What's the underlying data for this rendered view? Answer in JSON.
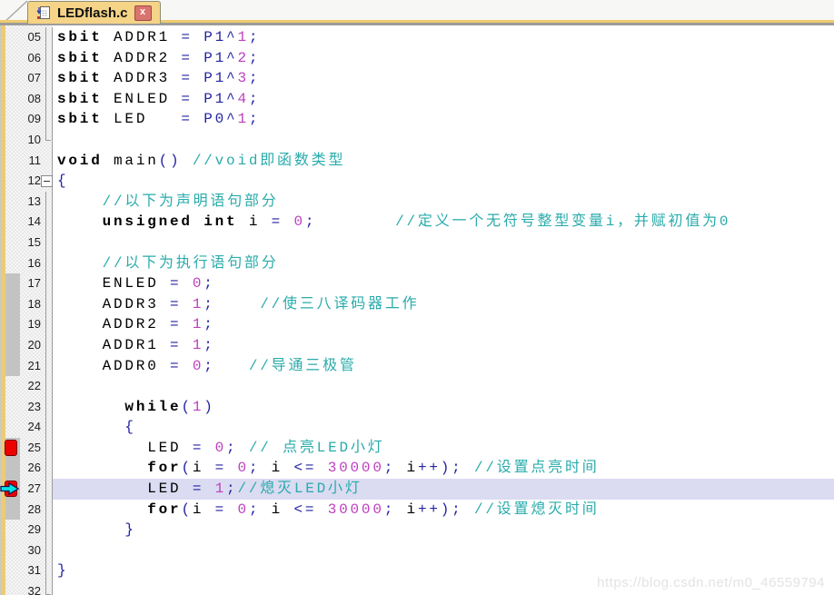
{
  "tab": {
    "title": "LEDflash.c",
    "close_glyph": "x"
  },
  "watermark": "https://blog.csdn.net/m0_46559794",
  "colors": {
    "keyword": "#000000",
    "operator": "#2323A3",
    "number": "#BE3FBE",
    "comment": "#2AABAB",
    "highlight": "#DBDBF2",
    "grayblock": "#C3C3C3",
    "breakpoint": "#EC0000",
    "arrow": "#00E5E5",
    "tab_bg": "#F5D387",
    "tab_border": "#8F8F71",
    "gold": "#EFCB6E",
    "graybar": "#9C9C9C",
    "close_bg": "#D9736E",
    "strip": "#EDCB72",
    "sep": "#9C9C9C",
    "lnum_color": "#1C1C1C",
    "watermark": "#E3E3E3",
    "pattern_a": "#E8E8E8",
    "pattern_b": "#F6F6F6"
  },
  "editor": {
    "lines": [
      {
        "num": "05",
        "f": "line",
        "seg": [
          [
            "k",
            "sbit"
          ],
          [
            "i",
            " ADDR1 "
          ],
          [
            "o",
            "="
          ],
          [
            "i",
            " "
          ],
          [
            "p",
            "P1"
          ],
          [
            "o",
            "^"
          ],
          [
            "n",
            "1"
          ],
          [
            "o",
            ";"
          ]
        ]
      },
      {
        "num": "06",
        "f": "line",
        "seg": [
          [
            "k",
            "sbit"
          ],
          [
            "i",
            " ADDR2 "
          ],
          [
            "o",
            "="
          ],
          [
            "i",
            " "
          ],
          [
            "p",
            "P1"
          ],
          [
            "o",
            "^"
          ],
          [
            "n",
            "2"
          ],
          [
            "o",
            ";"
          ]
        ]
      },
      {
        "num": "07",
        "f": "line",
        "seg": [
          [
            "k",
            "sbit"
          ],
          [
            "i",
            " ADDR3 "
          ],
          [
            "o",
            "="
          ],
          [
            "i",
            " "
          ],
          [
            "p",
            "P1"
          ],
          [
            "o",
            "^"
          ],
          [
            "n",
            "3"
          ],
          [
            "o",
            ";"
          ]
        ]
      },
      {
        "num": "08",
        "f": "line",
        "seg": [
          [
            "k",
            "sbit"
          ],
          [
            "i",
            " ENLED "
          ],
          [
            "o",
            "="
          ],
          [
            "i",
            " "
          ],
          [
            "p",
            "P1"
          ],
          [
            "o",
            "^"
          ],
          [
            "n",
            "4"
          ],
          [
            "o",
            ";"
          ]
        ]
      },
      {
        "num": "09",
        "f": "line",
        "seg": [
          [
            "k",
            "sbit"
          ],
          [
            "i",
            " LED   "
          ],
          [
            "o",
            "="
          ],
          [
            "i",
            " "
          ],
          [
            "p",
            "P0"
          ],
          [
            "o",
            "^"
          ],
          [
            "n",
            "1"
          ],
          [
            "o",
            ";"
          ]
        ]
      },
      {
        "num": "10",
        "f": "end",
        "seg": []
      },
      {
        "num": "11",
        "seg": [
          [
            "k",
            "void"
          ],
          [
            "i",
            " main"
          ],
          [
            "o",
            "()"
          ],
          [
            "i",
            " "
          ],
          [
            "c",
            "//void即函数类型"
          ]
        ]
      },
      {
        "num": "12",
        "f": "box",
        "seg": [
          [
            "o",
            "{"
          ]
        ]
      },
      {
        "num": "13",
        "f": "line",
        "seg": [
          [
            "i",
            "    "
          ],
          [
            "c",
            "//以下为声明语句部分"
          ]
        ]
      },
      {
        "num": "14",
        "f": "line",
        "seg": [
          [
            "i",
            "    "
          ],
          [
            "k",
            "unsigned"
          ],
          [
            "i",
            " "
          ],
          [
            "k",
            "int"
          ],
          [
            "i",
            " i "
          ],
          [
            "o",
            "="
          ],
          [
            "i",
            " "
          ],
          [
            "n",
            "0"
          ],
          [
            "o",
            ";"
          ],
          [
            "i",
            "       "
          ],
          [
            "c",
            "//定义一个无符号整型变量i，并赋初值为0"
          ]
        ]
      },
      {
        "num": "15",
        "f": "line",
        "seg": []
      },
      {
        "num": "16",
        "f": "line",
        "seg": [
          [
            "i",
            "    "
          ],
          [
            "c",
            "//以下为执行语句部分"
          ]
        ]
      },
      {
        "num": "17",
        "f": "line",
        "gray": true,
        "seg": [
          [
            "i",
            "    ENLED "
          ],
          [
            "o",
            "="
          ],
          [
            "i",
            " "
          ],
          [
            "n",
            "0"
          ],
          [
            "o",
            ";"
          ]
        ]
      },
      {
        "num": "18",
        "f": "line",
        "gray": true,
        "seg": [
          [
            "i",
            "    ADDR3 "
          ],
          [
            "o",
            "="
          ],
          [
            "i",
            " "
          ],
          [
            "n",
            "1"
          ],
          [
            "o",
            ";"
          ],
          [
            "i",
            "    "
          ],
          [
            "c",
            "//使三八译码器工作"
          ]
        ]
      },
      {
        "num": "19",
        "f": "line",
        "gray": true,
        "seg": [
          [
            "i",
            "    ADDR2 "
          ],
          [
            "o",
            "="
          ],
          [
            "i",
            " "
          ],
          [
            "n",
            "1"
          ],
          [
            "o",
            ";"
          ]
        ]
      },
      {
        "num": "20",
        "f": "line",
        "gray": true,
        "seg": [
          [
            "i",
            "    ADDR1 "
          ],
          [
            "o",
            "="
          ],
          [
            "i",
            " "
          ],
          [
            "n",
            "1"
          ],
          [
            "o",
            ";"
          ]
        ]
      },
      {
        "num": "21",
        "f": "line",
        "gray": true,
        "seg": [
          [
            "i",
            "    ADDR0 "
          ],
          [
            "o",
            "="
          ],
          [
            "i",
            " "
          ],
          [
            "n",
            "0"
          ],
          [
            "o",
            ";"
          ],
          [
            "i",
            "   "
          ],
          [
            "c",
            "//导通三极管"
          ]
        ]
      },
      {
        "num": "22",
        "f": "line",
        "seg": []
      },
      {
        "num": "23",
        "f": "line",
        "seg": [
          [
            "i",
            "      "
          ],
          [
            "k",
            "while"
          ],
          [
            "o",
            "("
          ],
          [
            "n",
            "1"
          ],
          [
            "o",
            ")"
          ]
        ]
      },
      {
        "num": "24",
        "f": "line",
        "seg": [
          [
            "i",
            "      "
          ],
          [
            "o",
            "{"
          ]
        ]
      },
      {
        "num": "25",
        "f": "line",
        "gray": true,
        "bp": true,
        "seg": [
          [
            "i",
            "        LED "
          ],
          [
            "o",
            "="
          ],
          [
            "i",
            " "
          ],
          [
            "n",
            "0"
          ],
          [
            "o",
            ";"
          ],
          [
            "i",
            " "
          ],
          [
            "c",
            "// 点亮LED小灯"
          ]
        ]
      },
      {
        "num": "26",
        "f": "line",
        "gray": true,
        "seg": [
          [
            "i",
            "        "
          ],
          [
            "k",
            "for"
          ],
          [
            "o",
            "("
          ],
          [
            "i",
            "i "
          ],
          [
            "o",
            "="
          ],
          [
            "i",
            " "
          ],
          [
            "n",
            "0"
          ],
          [
            "o",
            ";"
          ],
          [
            "i",
            " i "
          ],
          [
            "o",
            "<="
          ],
          [
            "i",
            " "
          ],
          [
            "n",
            "30000"
          ],
          [
            "o",
            ";"
          ],
          [
            "i",
            " i"
          ],
          [
            "o",
            "++);"
          ],
          [
            "i",
            " "
          ],
          [
            "c",
            "//设置点亮时间"
          ]
        ]
      },
      {
        "num": "27",
        "f": "line",
        "gray": true,
        "bp": true,
        "arrow": true,
        "hl": true,
        "seg": [
          [
            "i",
            "        LED "
          ],
          [
            "o",
            "="
          ],
          [
            "i",
            " "
          ],
          [
            "n",
            "1"
          ],
          [
            "o",
            ";"
          ],
          [
            "c",
            "//熄灭LED小灯"
          ]
        ]
      },
      {
        "num": "28",
        "f": "line",
        "gray": true,
        "seg": [
          [
            "i",
            "        "
          ],
          [
            "k",
            "for"
          ],
          [
            "o",
            "("
          ],
          [
            "i",
            "i "
          ],
          [
            "o",
            "="
          ],
          [
            "i",
            " "
          ],
          [
            "n",
            "0"
          ],
          [
            "o",
            ";"
          ],
          [
            "i",
            " i "
          ],
          [
            "o",
            "<="
          ],
          [
            "i",
            " "
          ],
          [
            "n",
            "30000"
          ],
          [
            "o",
            ";"
          ],
          [
            "i",
            " i"
          ],
          [
            "o",
            "++);"
          ],
          [
            "i",
            " "
          ],
          [
            "c",
            "//设置熄灭时间"
          ]
        ]
      },
      {
        "num": "29",
        "f": "line",
        "seg": [
          [
            "i",
            "      "
          ],
          [
            "o",
            "}"
          ]
        ]
      },
      {
        "num": "30",
        "f": "line",
        "seg": []
      },
      {
        "num": "31",
        "f": "line",
        "seg": [
          [
            "o",
            "}"
          ]
        ]
      },
      {
        "num": "32",
        "f": "bend",
        "seg": []
      }
    ]
  }
}
